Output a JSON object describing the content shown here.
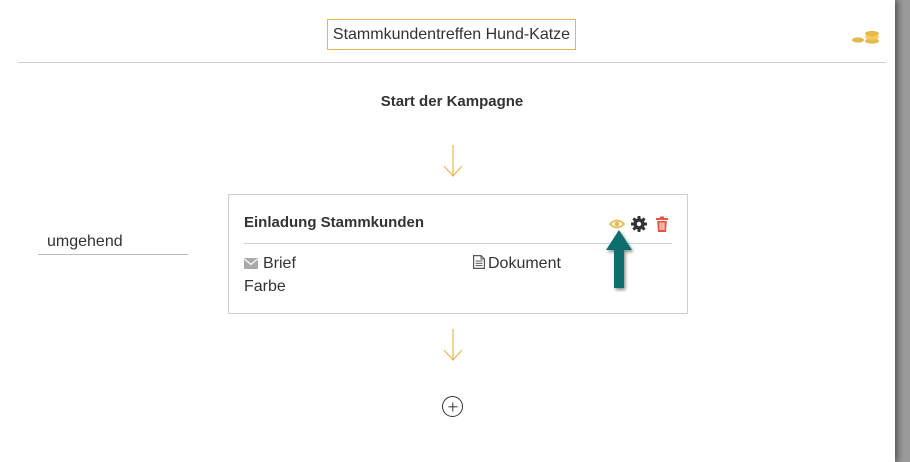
{
  "campaign": {
    "title": "Stammkundentreffen Hund-Katze"
  },
  "flow": {
    "start_label": "Start der Kampagne"
  },
  "timing": {
    "value": "umgehend"
  },
  "step": {
    "title": "Einladung Stammkunden",
    "type": "Brief",
    "document": "Dokument",
    "color": "Farbe"
  },
  "colors": {
    "accent": "#e7b94a",
    "delete": "#e8543f",
    "pointer_arrow": "#0b6e6e",
    "text": "#333333"
  },
  "icons": {
    "coins": "coins-icon",
    "preview": "eye-icon",
    "settings": "gear-icon",
    "delete": "trash-icon",
    "letter": "envelope-icon",
    "document": "document-icon",
    "add": "plus-circle-icon",
    "flow_arrow": "arrow-down-icon"
  }
}
